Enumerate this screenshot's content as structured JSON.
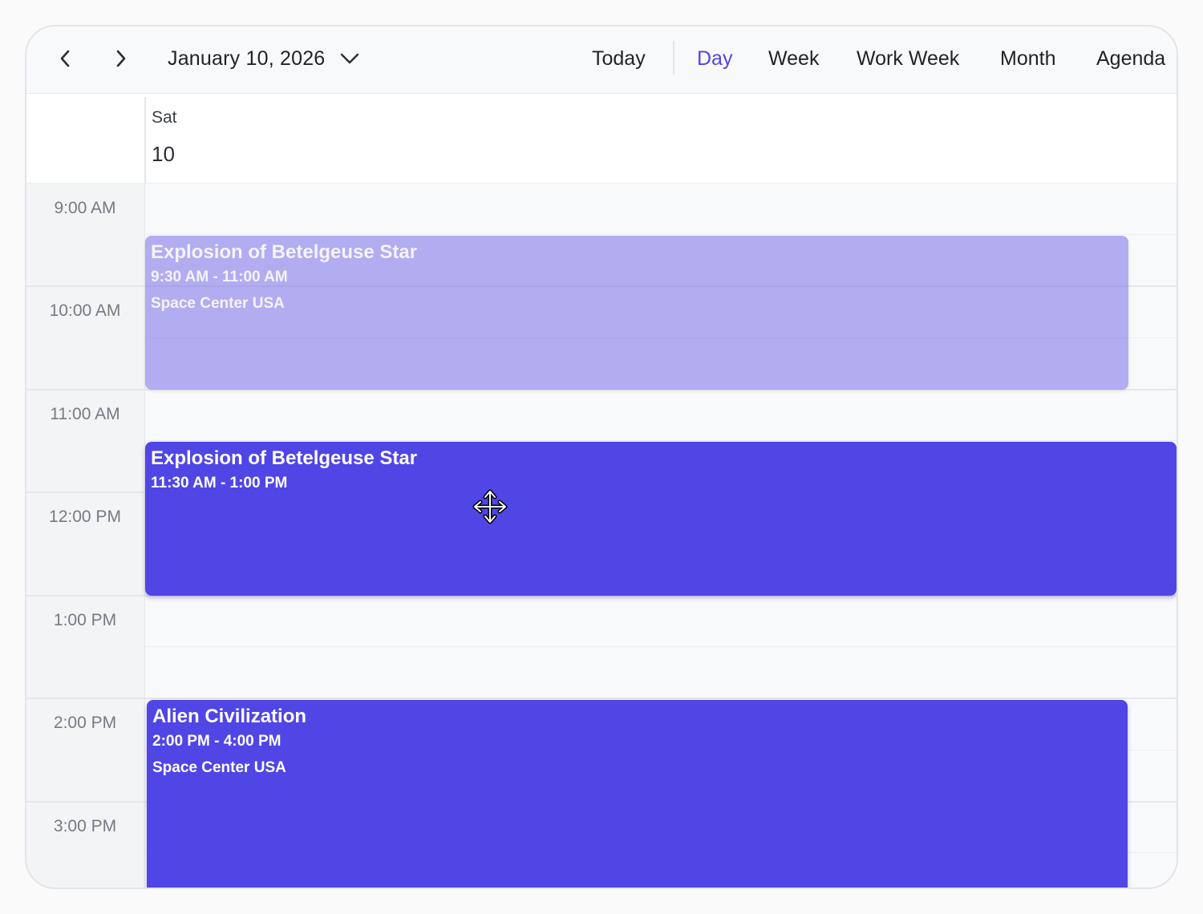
{
  "toolbar": {
    "prev_icon": "chevron-left-icon",
    "next_icon": "chevron-right-icon",
    "date_label": "January 10, 2026",
    "date_dropdown_icon": "chevron-down-icon",
    "today_label": "Today",
    "views": [
      {
        "label": "Day",
        "active": true
      },
      {
        "label": "Week",
        "active": false
      },
      {
        "label": "Work Week",
        "active": false
      },
      {
        "label": "Month",
        "active": false
      },
      {
        "label": "Agenda",
        "active": false
      }
    ]
  },
  "day_header": {
    "day_name": "Sat",
    "day_number": "10"
  },
  "time_slots": [
    "9:00 AM",
    "10:00 AM",
    "11:00 AM",
    "12:00 PM",
    "1:00 PM",
    "2:00 PM",
    "3:00 PM"
  ],
  "events": [
    {
      "title": "Explosion of Betelgeuse Star",
      "time": "9:30 AM - 11:00 AM",
      "location": "Space Center USA",
      "state": "drag-origin"
    },
    {
      "title": "Explosion of Betelgeuse Star",
      "time": "11:30 AM - 1:00 PM",
      "location": "",
      "state": "dragging"
    },
    {
      "title": "Alien Civilization",
      "time": "2:00 PM - 4:00 PM",
      "location": "Space Center USA",
      "state": "normal"
    }
  ],
  "colors": {
    "accent": "#4f46e5",
    "event": "#5046e5",
    "event_ghost": "#b3aff2"
  },
  "cursor_icon": "move-cursor-icon"
}
